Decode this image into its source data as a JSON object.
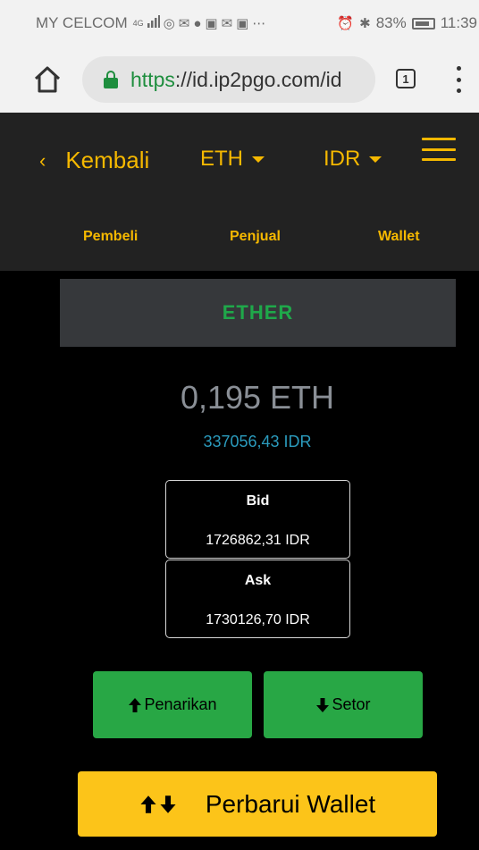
{
  "status_bar": {
    "carrier": "MY CELCOM",
    "network": "4G",
    "battery": "83%",
    "time": "11:39"
  },
  "browser": {
    "url_scheme": "https",
    "url_rest": "://id.ip2pgo.com/id",
    "tab_count": "1"
  },
  "header": {
    "back_label": "Kembali",
    "coin_selector": "ETH",
    "fiat_selector": "IDR",
    "subnav": [
      "Pembeli",
      "Penjual",
      "Wallet"
    ]
  },
  "wallet": {
    "coin_name": "ETHER",
    "balance": "0,195 ETH",
    "balance_idr": "337056,43 IDR",
    "bid_label": "Bid",
    "bid_value": "1726862,31 IDR",
    "ask_label": "Ask",
    "ask_value": "1730126,70 IDR"
  },
  "actions": {
    "withdraw_label": "Penarikan",
    "deposit_label": "Setor",
    "refresh_label": "Perbarui Wallet"
  },
  "colors": {
    "accent": "#f5b800",
    "success": "#28a745",
    "coin_name": "#1fa84a",
    "fiat_balance": "#2b9bbd",
    "refresh_button": "#fcc419"
  },
  "icons": [
    "home-icon",
    "lock-icon",
    "tabs-icon",
    "more-vert-icon",
    "chevron-left-icon",
    "caret-down-icon",
    "hamburger-menu-icon",
    "arrow-up-icon",
    "arrow-down-icon"
  ]
}
